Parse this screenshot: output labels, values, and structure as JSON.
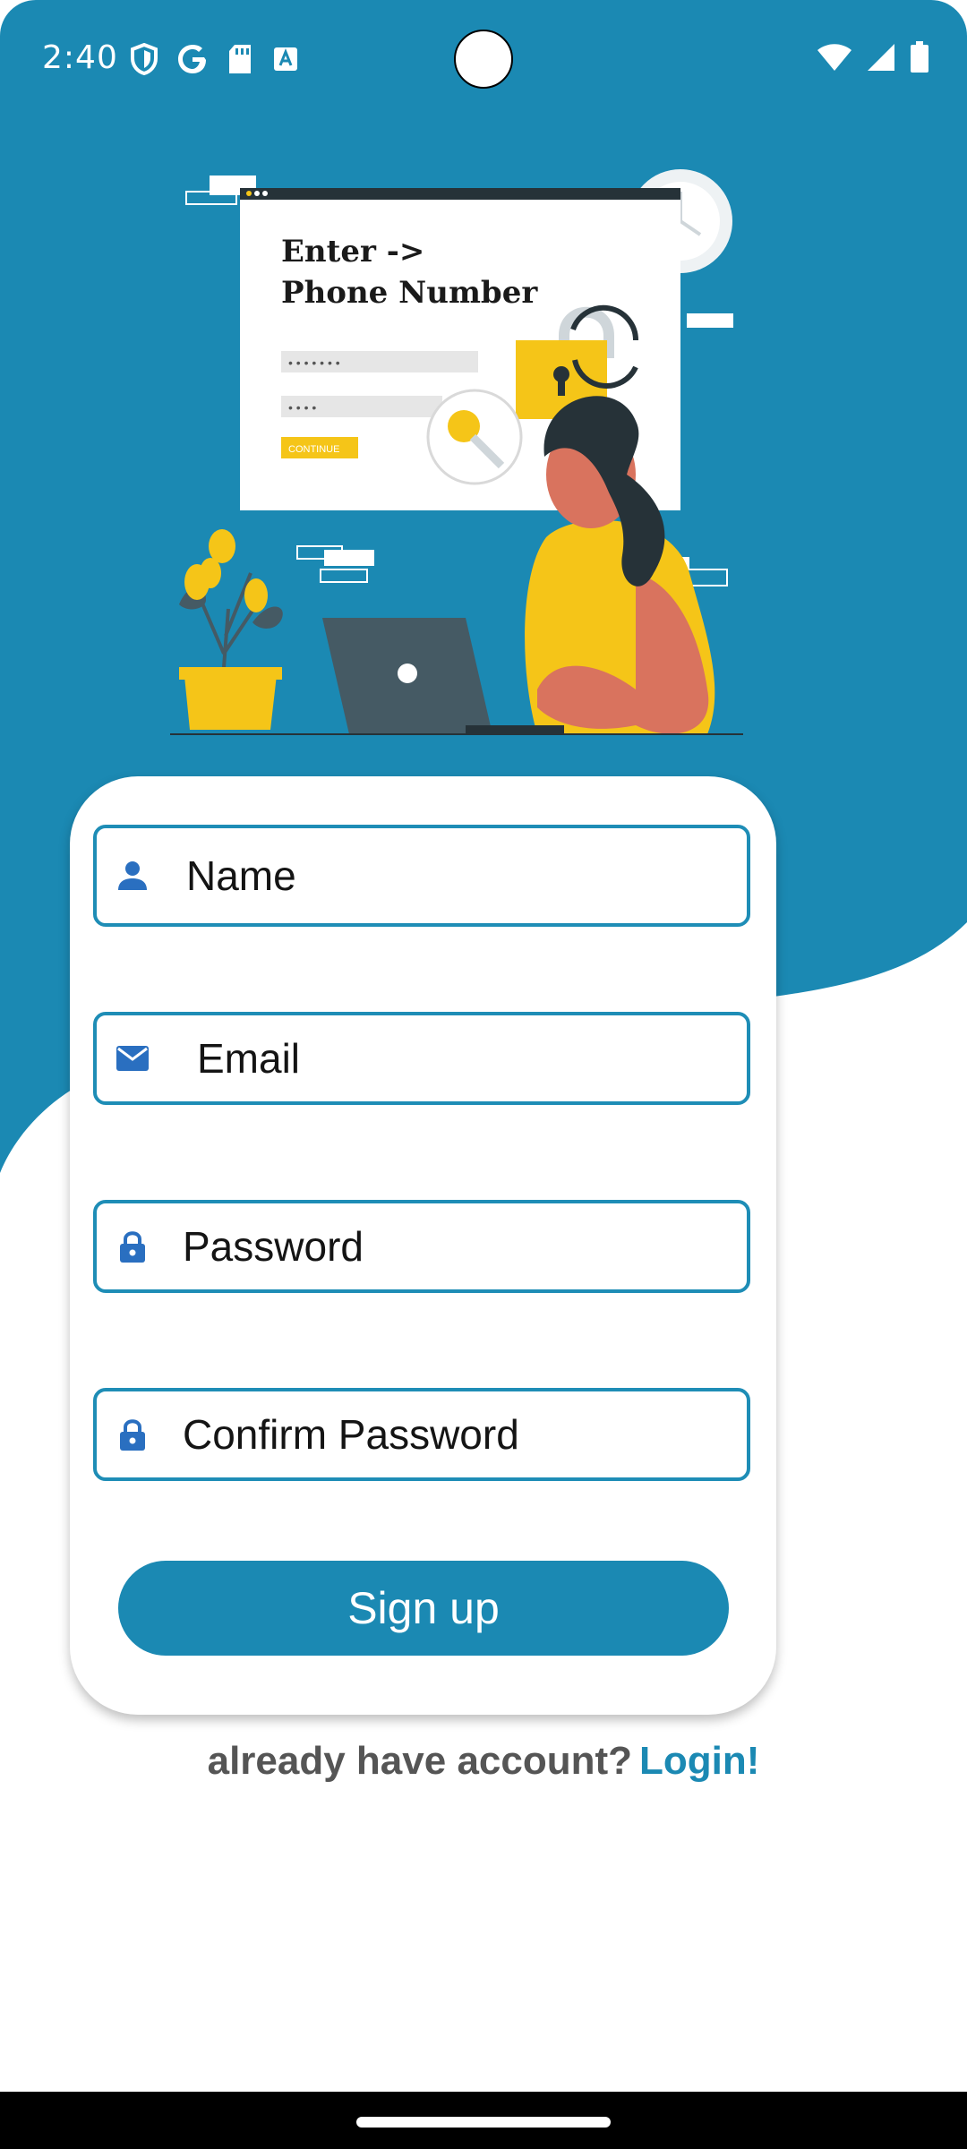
{
  "status_bar": {
    "time": "2:40"
  },
  "illustration": {
    "heading_line1": "Enter  ->",
    "heading_line2": "Phone Number",
    "field1_dots": "• • • • • • •",
    "field2_dots": "• • • •",
    "continue_label": "CONTINUE"
  },
  "form": {
    "name_placeholder": "Name",
    "email_placeholder": "Email",
    "password_placeholder": "Password",
    "confirm_password_placeholder": "Confirm Password",
    "signup_label": "Sign up"
  },
  "footer": {
    "question": "already have account?",
    "login_link": "Login!"
  },
  "colors": {
    "primary": "#1b89b3",
    "background": "#ffffff",
    "field_border": "#1e8db6",
    "icon": "#2a6fc0"
  }
}
